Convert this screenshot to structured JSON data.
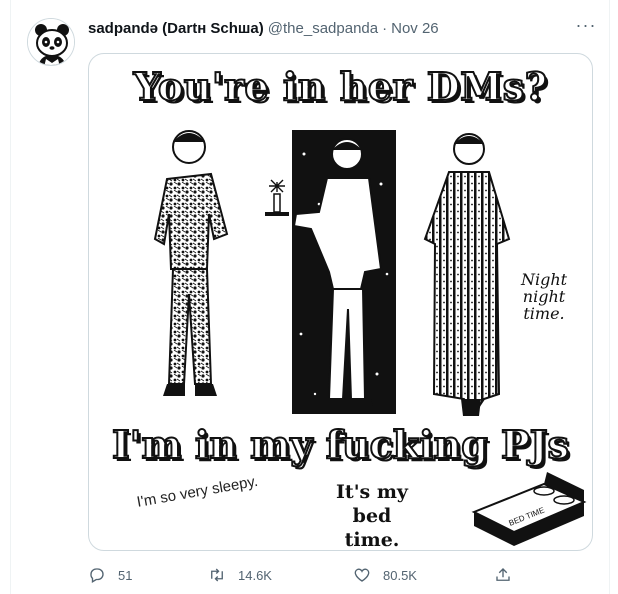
{
  "tweet": {
    "display_name": "sadpandə (Dartн Schшa)",
    "handle": "@the_sadpanda",
    "separator": "·",
    "date": "Nov 26",
    "more_label": "···"
  },
  "media": {
    "title": "You're in her DMs?",
    "caption": "I'm in my fucking PJs",
    "night_text": "Night night time.",
    "sleepy_text": "I'm so very sleepy.",
    "bedtime_text": "It's my bed time.",
    "bed_label": "BED TIME"
  },
  "actions": {
    "reply_count": "51",
    "retweet_count": "14.6K",
    "like_count": "80.5K"
  },
  "icons": {
    "avatar": "panda-avatar-icon",
    "reply": "reply-icon",
    "retweet": "retweet-icon",
    "like": "heart-icon",
    "share": "share-icon"
  }
}
